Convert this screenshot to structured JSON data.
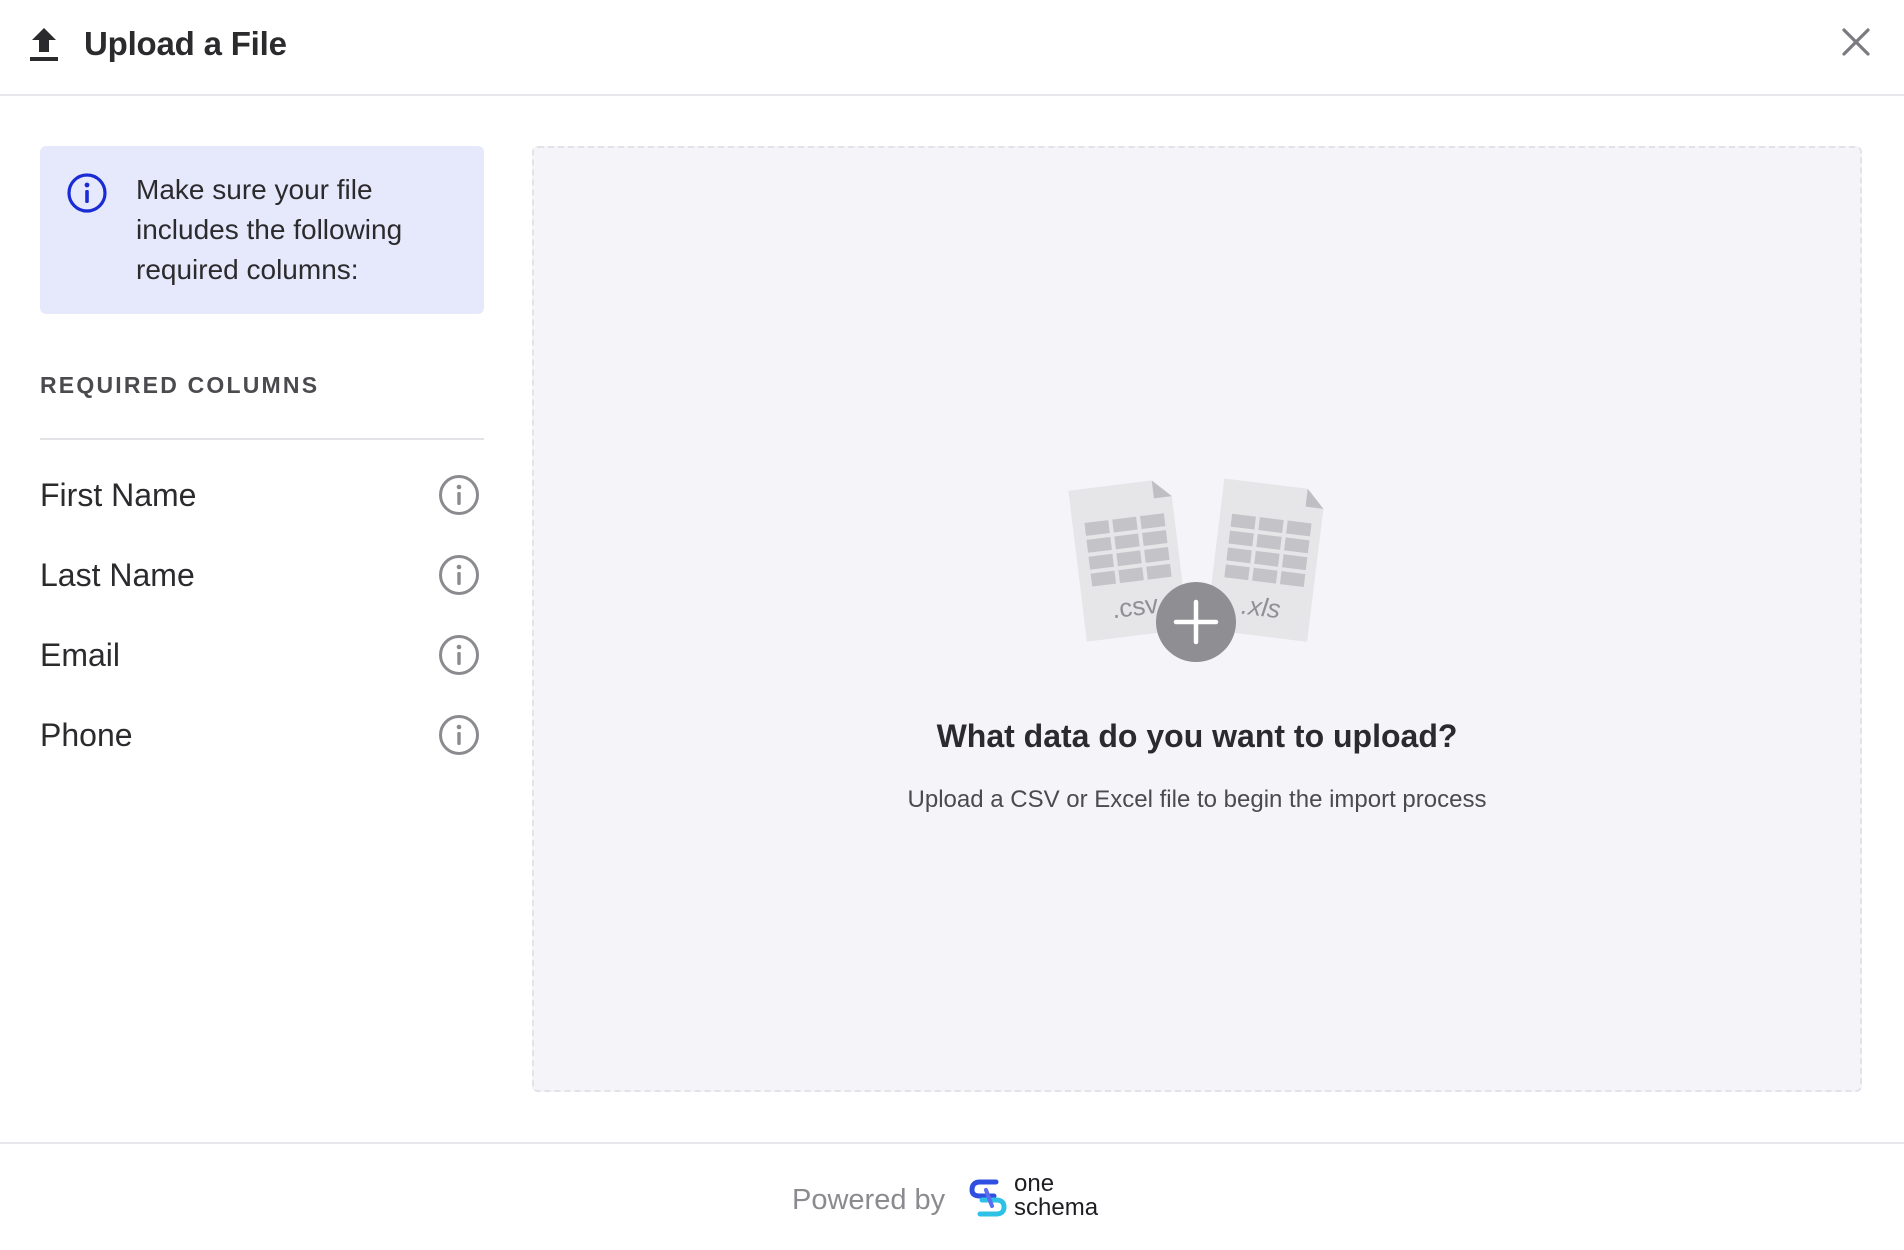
{
  "header": {
    "title": "Upload a File",
    "upload_icon": "upload-arrow-icon",
    "close_icon": "close-icon"
  },
  "info_banner": {
    "icon": "info-icon",
    "text": "Make sure your file includes the following required columns:",
    "background_color": "#e6e9fb",
    "icon_color": "#1a2bd6"
  },
  "required_columns": {
    "heading": "REQUIRED COLUMNS",
    "items": [
      {
        "label": "First Name",
        "icon": "info-icon"
      },
      {
        "label": "Last Name",
        "icon": "info-icon"
      },
      {
        "label": "Email",
        "icon": "info-icon"
      },
      {
        "label": "Phone",
        "icon": "info-icon"
      }
    ]
  },
  "dropzone": {
    "illustration": {
      "file_left_ext": ".csv",
      "file_right_ext": ".xls",
      "add_icon": "plus-icon"
    },
    "title": "What data do you want to upload?",
    "subtitle": "Upload a CSV or Excel file to begin the import process",
    "background_color": "#f5f5f9"
  },
  "footer": {
    "powered_by": "Powered by",
    "brand_line1": "one",
    "brand_line2": "schema",
    "brand_logo": "oneschema-logo-icon"
  }
}
